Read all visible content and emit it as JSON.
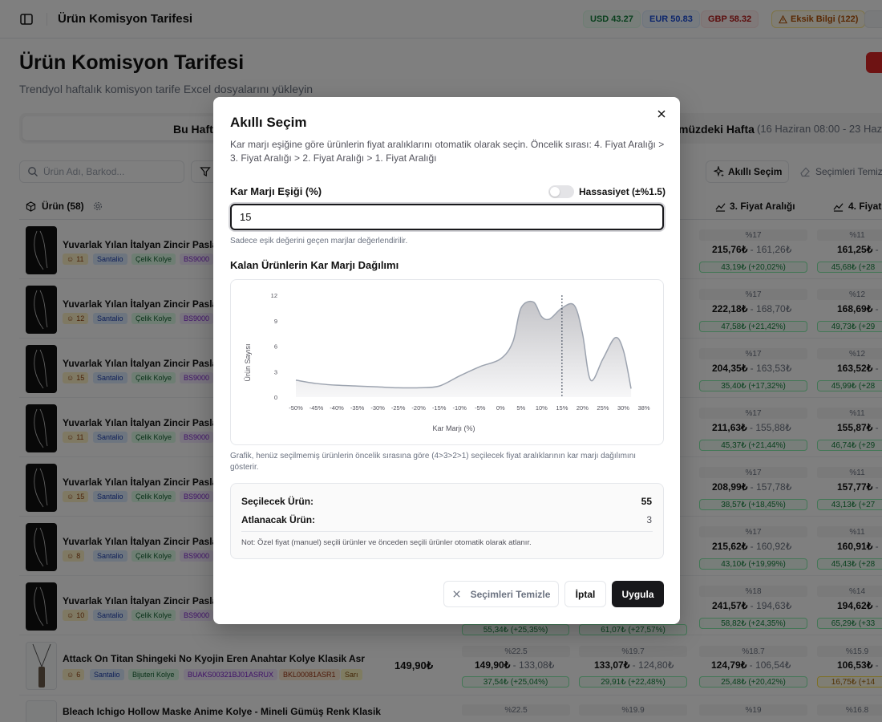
{
  "topbar": {
    "title": "Ürün Komisyon Tarifesi",
    "usd": "USD 43.27",
    "eur": "EUR 50.83",
    "gbp": "GBP 58.32",
    "missing_info": "Eksik Bilgi (122)"
  },
  "page": {
    "title": "Ürün Komisyon Tarifesi",
    "subtitle": "Trendyol haftalık komisyon tarife Excel dosyalarını yükleyin"
  },
  "week_tabs": {
    "this_week": "Bu Hafta",
    "next_week": "müzdeki Hafta",
    "next_week_range": "(16 Haziran 08:00 - 23 Hazir"
  },
  "toolbar": {
    "search_placeholder": "Ürün Adı, Barkod...",
    "smart_select": "Akıllı Seçim",
    "clear_selections": "Seçimleri Temiz"
  },
  "table": {
    "product_col": "Ürün (58)",
    "range3_col": "3. Fiyat Aralığı",
    "range4_col": "4. Fiyat"
  },
  "rows": [
    {
      "name": "Yuvarlak Yılan İtalyan Zincir Paslan",
      "stock": "11",
      "brand": "Santalio",
      "cat": "Çelik Kolye",
      "code": "BS9000",
      "c3_pct": "%17",
      "c3_hi": "215,76₺",
      "c3_lo": "161,26₺",
      "c3_profit": "43,19₺ (+20,02%)",
      "c4_pct": "%11",
      "c4_hi": "161,25₺",
      "c4_profit": "45,68₺ (+28"
    },
    {
      "name": "Yuvarlak Yılan İtalyan Zincir Paslan",
      "stock": "12",
      "brand": "Santalio",
      "cat": "Çelik Kolye",
      "code": "BS9000",
      "c3_pct": "%17",
      "c3_hi": "222,18₺",
      "c3_lo": "168,70₺",
      "c3_profit": "47,58₺ (+21,42%)",
      "c4_pct": "%12",
      "c4_hi": "168,69₺",
      "c4_profit": "49,73₺ (+29"
    },
    {
      "name": "Yuvarlak Yılan İtalyan Zincir Paslan",
      "stock": "15",
      "brand": "Santalio",
      "cat": "Çelik Kolye",
      "code": "BS9000",
      "c3_pct": "%17",
      "c3_hi": "204,35₺",
      "c3_lo": "163,53₺",
      "c3_profit": "35,40₺ (+17,32%)",
      "c4_pct": "%12",
      "c4_hi": "163,52₺",
      "c4_profit": "45,99₺ (+28"
    },
    {
      "name": "Yuvarlak Yılan İtalyan Zincir Paslan",
      "stock": "11",
      "brand": "Santalio",
      "cat": "Çelik Kolye",
      "code": "BS9000",
      "c3_pct": "%17",
      "c3_hi": "211,63₺",
      "c3_lo": "155,88₺",
      "c3_profit": "45,37₺ (+21,44%)",
      "c4_pct": "%11",
      "c4_hi": "155,87₺",
      "c4_profit": "46,74₺ (+29"
    },
    {
      "name": "Yuvarlak Yılan İtalyan Zincir Paslan",
      "stock": "15",
      "brand": "Santalio",
      "cat": "Çelik Kolye",
      "code": "BS9000",
      "c3_pct": "%17",
      "c3_hi": "208,99₺",
      "c3_lo": "157,78₺",
      "c3_profit": "38,57₺ (+18,45%)",
      "c4_pct": "%11",
      "c4_hi": "157,77₺",
      "c4_profit": "43,13₺ (+27"
    },
    {
      "name": "Yuvarlak Yılan İtalyan Zincir Paslan",
      "stock": "8",
      "brand": "Santalio",
      "cat": "Çelik Kolye",
      "code": "BS9000",
      "c3_pct": "%17",
      "c3_hi": "215,62₺",
      "c3_lo": "160,92₺",
      "c3_profit": "43,10₺ (+19,99%)",
      "c4_pct": "%11",
      "c4_hi": "160,91₺",
      "c4_profit": "45,43₺ (+28"
    },
    {
      "name": "Yuvarlak Yılan İtalyan Zincir Paslan",
      "stock": "10",
      "brand": "Santalio",
      "cat": "Çelik Kolye",
      "code": "BS9000",
      "c1_profit": "55,34₺ (+25,35%)",
      "c2_profit": "61,07₺ (+27,57%)",
      "c3_pct": "%18",
      "c3_hi": "241,57₺",
      "c3_lo": "194,63₺",
      "c3_profit": "58,82₺ (+24,35%)",
      "c4_pct": "%14",
      "c4_hi": "194,62₺",
      "c4_profit": "65,29₺ (+33"
    }
  ],
  "attack_row": {
    "name": "Attack On Titan Shingeki No Kyojin Eren Anahtar Kolye Klasik Asr",
    "stock": "6",
    "brand": "Santalio",
    "cat": "Bijuteri Kolye",
    "code": "BUAKS00321BJ01ASRUX",
    "bkl": "BKL00081ASR1",
    "color": "Sarı",
    "base": "149,90₺",
    "c1_pct": "%22.5",
    "c1_hi": "149,90₺",
    "c1_lo": "133,08₺",
    "c1_profit": "37,54₺ (+25,04%)",
    "c2_pct": "%19.7",
    "c2_hi": "133,07₺",
    "c2_lo": "124,80₺",
    "c2_profit": "29,91₺ (+22,48%)",
    "c3_pct": "%18.7",
    "c3_hi": "124,79₺",
    "c3_lo": "106,54₺",
    "c3_profit": "25,48₺ (+20,42%)",
    "c4_pct": "%15.9",
    "c4_hi": "106,53₺",
    "c4_profit": "16,75₺ (+14"
  },
  "bleach_row": {
    "name": "Bleach Ichigo Hollow Maske Anime Kolye - Mineli Gümüş Renk Klasik",
    "c1_pct": "%22.5",
    "c2_pct": "%19.9",
    "c3_pct": "%19",
    "c4_pct": "%16.8"
  },
  "modal": {
    "title": "Akıllı Seçim",
    "description": "Kar marjı eşiğine göre ürünlerin fiyat aralıklarını otomatik olarak seçin. Öncelik sırası: 4. Fiyat Aralığı > 3. Fiyat Aralığı > 2. Fiyat Aralığı > 1. Fiyat Aralığı",
    "threshold_label": "Kar Marjı Eşiği (%)",
    "sensitivity_label": "Hassasiyet (±%1.5)",
    "threshold_value": "15",
    "threshold_hint": "Sadece eşik değerini geçen marjlar değerlendirilir.",
    "chart_title": "Kalan Ürünlerin Kar Marjı Dağılımı",
    "chart_note": "Grafik, henüz seçilmemiş ürünlerin öncelik sırasına göre (4>3>2>1) seçilecek fiyat aralıklarının kar marjı dağılımını gösterir.",
    "to_select_label": "Seçilecek Ürün:",
    "to_select_value": "55",
    "to_skip_label": "Atlanacak Ürün:",
    "to_skip_value": "3",
    "note": "Not: Özel fiyat (manuel) seçili ürünler ve önceden seçili ürünler otomatik olarak atlanır.",
    "clear_button": "Seçimleri Temizle",
    "cancel_button": "İptal",
    "apply_button": "Uygula"
  },
  "chart_data": {
    "type": "area",
    "title": "",
    "xlabel": "Kar Marjı (%)",
    "ylabel": "Ürün Sayısı",
    "x_ticks": [
      "-50%",
      "-45%",
      "-40%",
      "-35%",
      "-30%",
      "-25%",
      "-20%",
      "-15%",
      "-10%",
      "-5%",
      "0%",
      "5%",
      "10%",
      "15%",
      "20%",
      "25%",
      "30%",
      "38%"
    ],
    "y_ticks": [
      "0",
      "3",
      "6",
      "9",
      "12"
    ],
    "ylim": [
      0,
      12
    ],
    "x": [
      -50,
      -45,
      -40,
      -35,
      -30,
      -25,
      -20,
      -15,
      -10,
      -5,
      0,
      3,
      5,
      8,
      10,
      12,
      15,
      18,
      20,
      22,
      25,
      28,
      30,
      33
    ],
    "y": [
      2,
      1.6,
      1.4,
      1.3,
      1.2,
      1.1,
      1.1,
      1.3,
      2.5,
      3.6,
      4.5,
      6.5,
      10.5,
      11.2,
      9.5,
      9.2,
      10.5,
      10.8,
      7.5,
      2,
      4.5,
      7,
      5.5,
      1
    ],
    "threshold_x": 15,
    "grid": false,
    "colors": {
      "line": "#9ca3af",
      "fill_top": "#d4d4d8",
      "fill_bottom": "#f4f4f5",
      "threshold": "#374151"
    }
  }
}
